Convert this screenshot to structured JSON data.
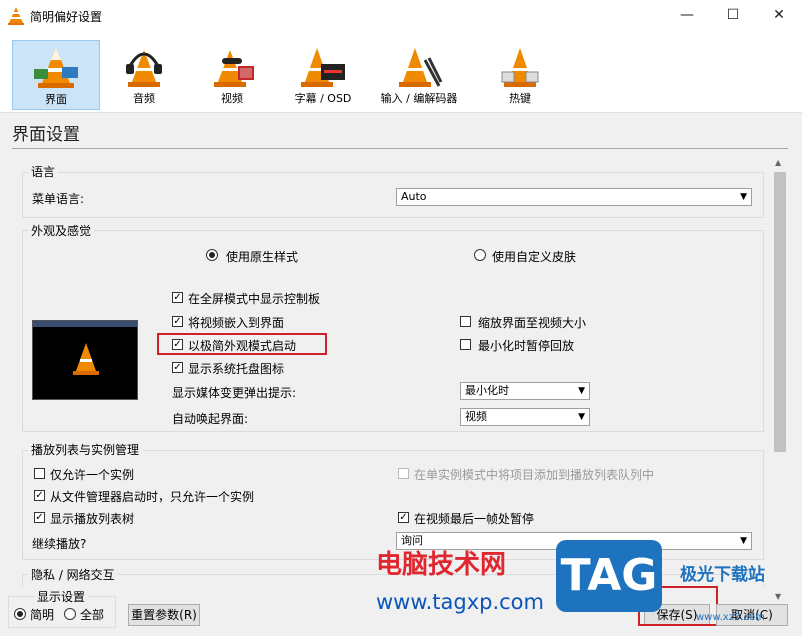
{
  "window": {
    "title": "简明偏好设置",
    "minimize": "—",
    "maximize": "☐",
    "close": "✕"
  },
  "toolbar": [
    {
      "label": "界面",
      "icon": "cone-interface-icon",
      "selected": true
    },
    {
      "label": "音频",
      "icon": "cone-headphones-icon"
    },
    {
      "label": "视频",
      "icon": "cone-video-icon"
    },
    {
      "label": "字幕 / OSD",
      "icon": "cone-subtitle-icon"
    },
    {
      "label": "输入 / 编解码器",
      "icon": "cone-input-icon"
    },
    {
      "label": "热键",
      "icon": "cone-hotkeys-icon"
    }
  ],
  "section_title": "界面设置",
  "language": {
    "group": "语言",
    "label": "菜单语言:",
    "value": "Auto"
  },
  "look": {
    "group": "外观及感觉",
    "radio_native": "使用原生样式",
    "radio_skin": "使用自定义皮肤",
    "cb_fullscreen_controls": "在全屏模式中显示控制板",
    "cb_embed_video": "将视频嵌入到界面",
    "cb_minimal_start": "以极简外观模式启动",
    "cb_systray": "显示系统托盘图标",
    "cb_resize": "缩放界面至视频大小",
    "cb_pause_minimized": "最小化时暂停回放",
    "media_popup_label": "显示媒体变更弹出提示:",
    "media_popup_value": "最小化时",
    "raise_label": "自动唤起界面:",
    "raise_value": "视频"
  },
  "playlist": {
    "group": "播放列表与实例管理",
    "cb_one_instance": "仅允许一个实例",
    "cb_enqueue": "在单实例模式中将项目添加到播放列表队列中",
    "cb_file_manager": "从文件管理器启动时，只允许一个实例",
    "cb_show_tree": "显示播放列表树",
    "cb_pause_last": "在视频最后一帧处暂停",
    "resume_label": "继续播放?",
    "resume_value": "询问"
  },
  "privacy": {
    "group": "隐私 / 网络交互"
  },
  "bottom": {
    "group": "显示设置",
    "radio_simple": "简明",
    "radio_all": "全部",
    "reset": "重置参数(R)",
    "save": "保存(S)",
    "cancel": "取消(C)"
  },
  "watermark": {
    "site_name": "电脑技术网",
    "url": "www.tagxp.com",
    "badge": "TAG",
    "right_text": "极光下载站",
    "right_url": "www.xz7.com"
  },
  "colors": {
    "accent_selected": "#cce4f7",
    "highlight_box": "#d0202a",
    "watermark_red": "#e0262f",
    "watermark_blue": "#1e73be"
  }
}
